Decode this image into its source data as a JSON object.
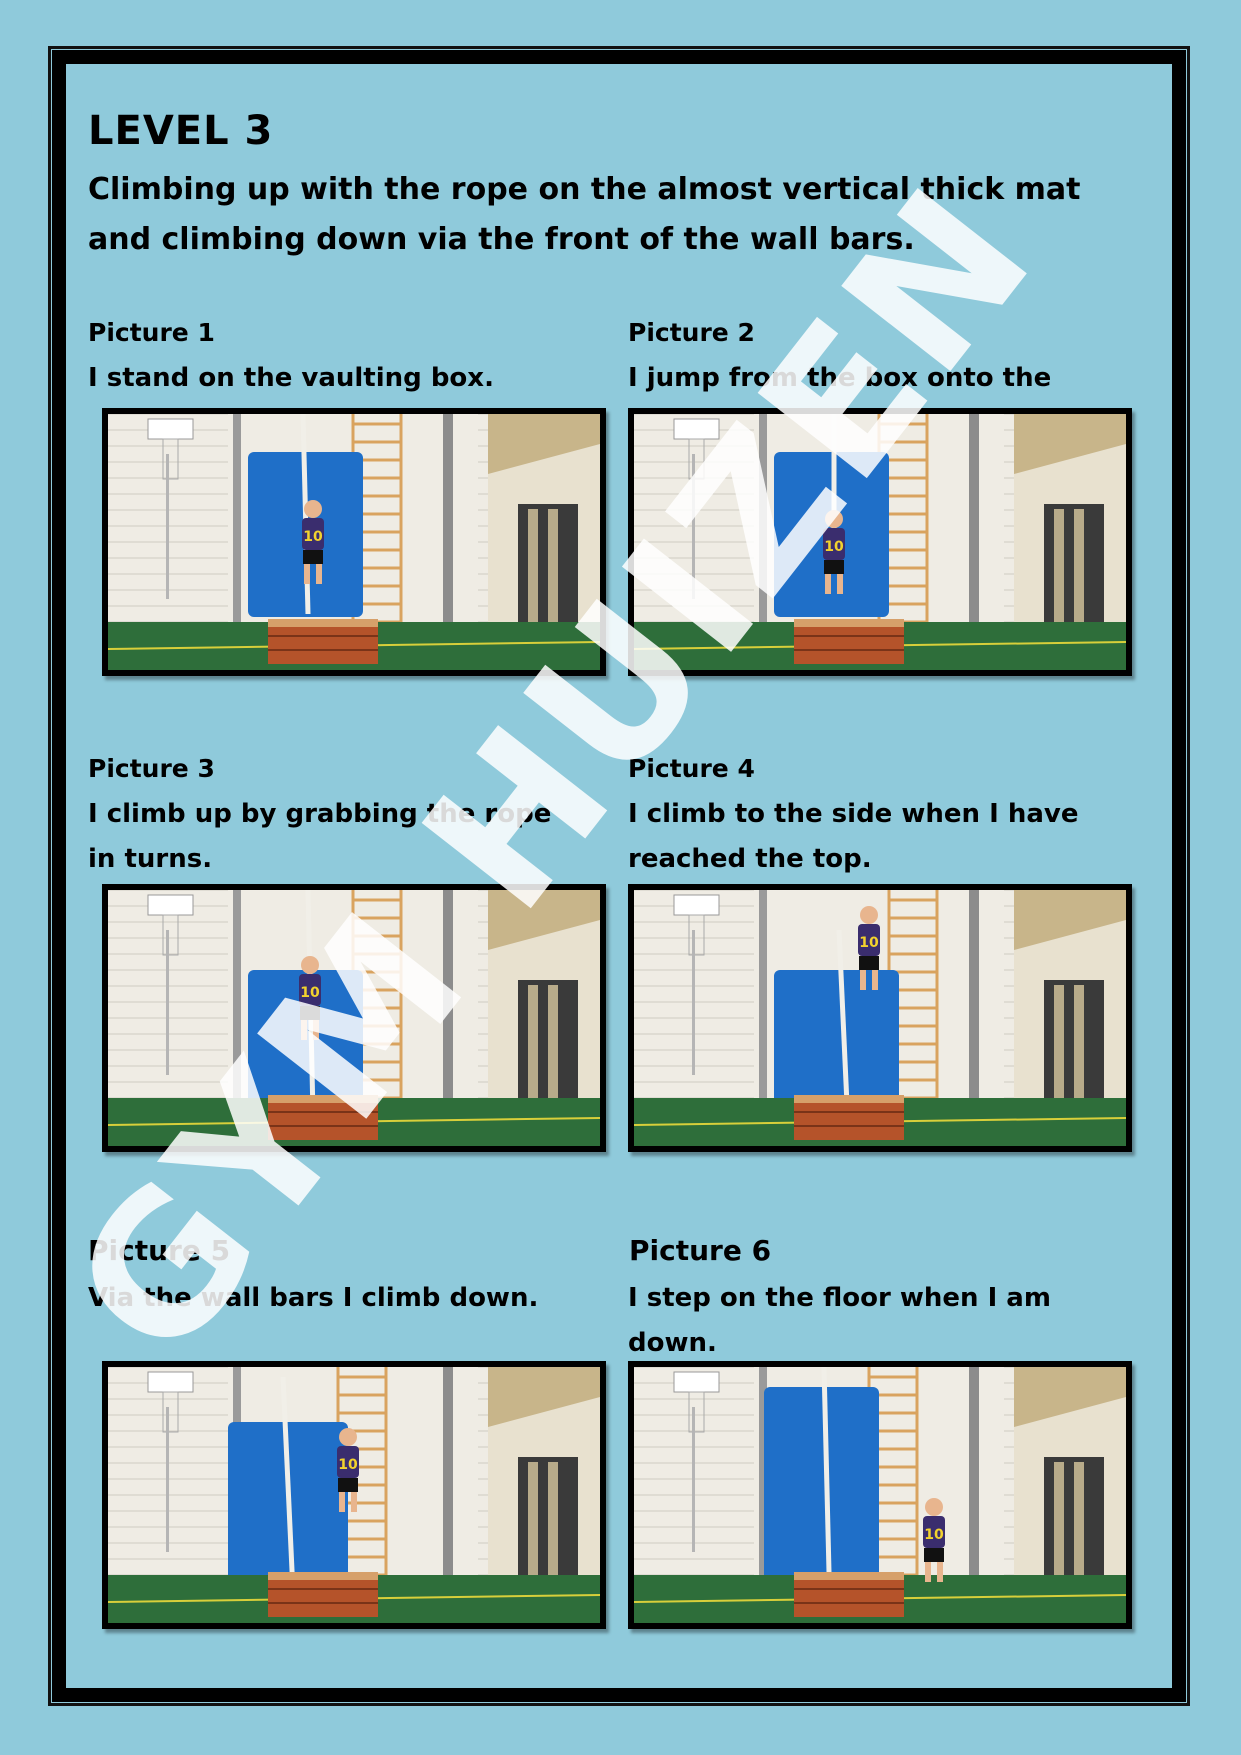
{
  "level_title": "LEVEL 3",
  "description": "Climbing up with the rope on the almost vertical thick mat and climbing down via the front of the wall bars.",
  "pictures": [
    {
      "label": "Picture 1",
      "caption": "I stand on the vaulting box."
    },
    {
      "label": "Picture 2",
      "caption": "I jump from the box onto the mat."
    },
    {
      "label": "Picture 3",
      "caption": "I climb up by grabbing the rope in turns."
    },
    {
      "label": "Picture 4",
      "caption": "I climb to the side when I have reached the top."
    },
    {
      "label": "Picture 5",
      "caption": "Via the wall bars I climb down."
    },
    {
      "label": "Picture 6",
      "caption": "I step on the floor when I am down."
    }
  ],
  "watermark": "GYM HUIZEN",
  "jersey_number": "10",
  "colors": {
    "background": "#8fcadb",
    "mat": "#1f6fc8",
    "floor": "#2e6e3a",
    "box": "#b5532a"
  }
}
